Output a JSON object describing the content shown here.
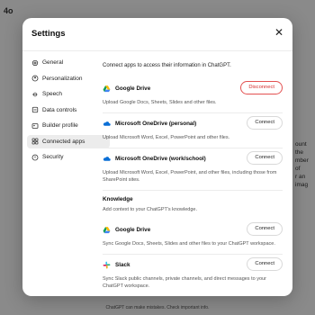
{
  "background": {
    "model": "4o",
    "side_text": [
      "ount the",
      "mber of",
      "r an imag"
    ],
    "footer": "ChatGPT can make mistakes. Check important info."
  },
  "modal": {
    "title": "Settings",
    "close_icon": "close-icon",
    "nav": [
      {
        "label": "General",
        "icon": "gear-icon"
      },
      {
        "label": "Personalization",
        "icon": "personalization-icon"
      },
      {
        "label": "Speech",
        "icon": "speech-icon"
      },
      {
        "label": "Data controls",
        "icon": "data-controls-icon"
      },
      {
        "label": "Builder profile",
        "icon": "builder-profile-icon"
      },
      {
        "label": "Connected apps",
        "icon": "connected-apps-icon",
        "active": true
      },
      {
        "label": "Security",
        "icon": "security-icon"
      }
    ],
    "intro": "Connect apps to access their information in ChatGPT.",
    "apps": [
      {
        "name": "Google Drive",
        "desc": "Upload Google Docs, Sheets, Slides and other files.",
        "button": "Disconnect"
      },
      {
        "name": "Microsoft OneDrive (personal)",
        "desc": "Upload Microsoft Word, Excel, PowerPoint and other files.",
        "button": "Connect"
      },
      {
        "name": "Microsoft OneDrive (work/school)",
        "desc": "Upload Microsoft Word, Excel, PowerPoint, and other files, including those from SharePoint sites.",
        "button": "Connect"
      }
    ],
    "knowledge": {
      "title": "Knowledge",
      "subtitle": "Add context to your ChatGPT's knowledge.",
      "apps": [
        {
          "name": "Google Drive",
          "desc": "Sync Google Docs, Sheets, Slides and other files to your ChatGPT workspace.",
          "button": "Connect"
        },
        {
          "name": "Slack",
          "desc": "Sync Slack public channels, private channels, and direct messages to your ChatGPT workspace.",
          "button": "Connect"
        }
      ]
    }
  }
}
